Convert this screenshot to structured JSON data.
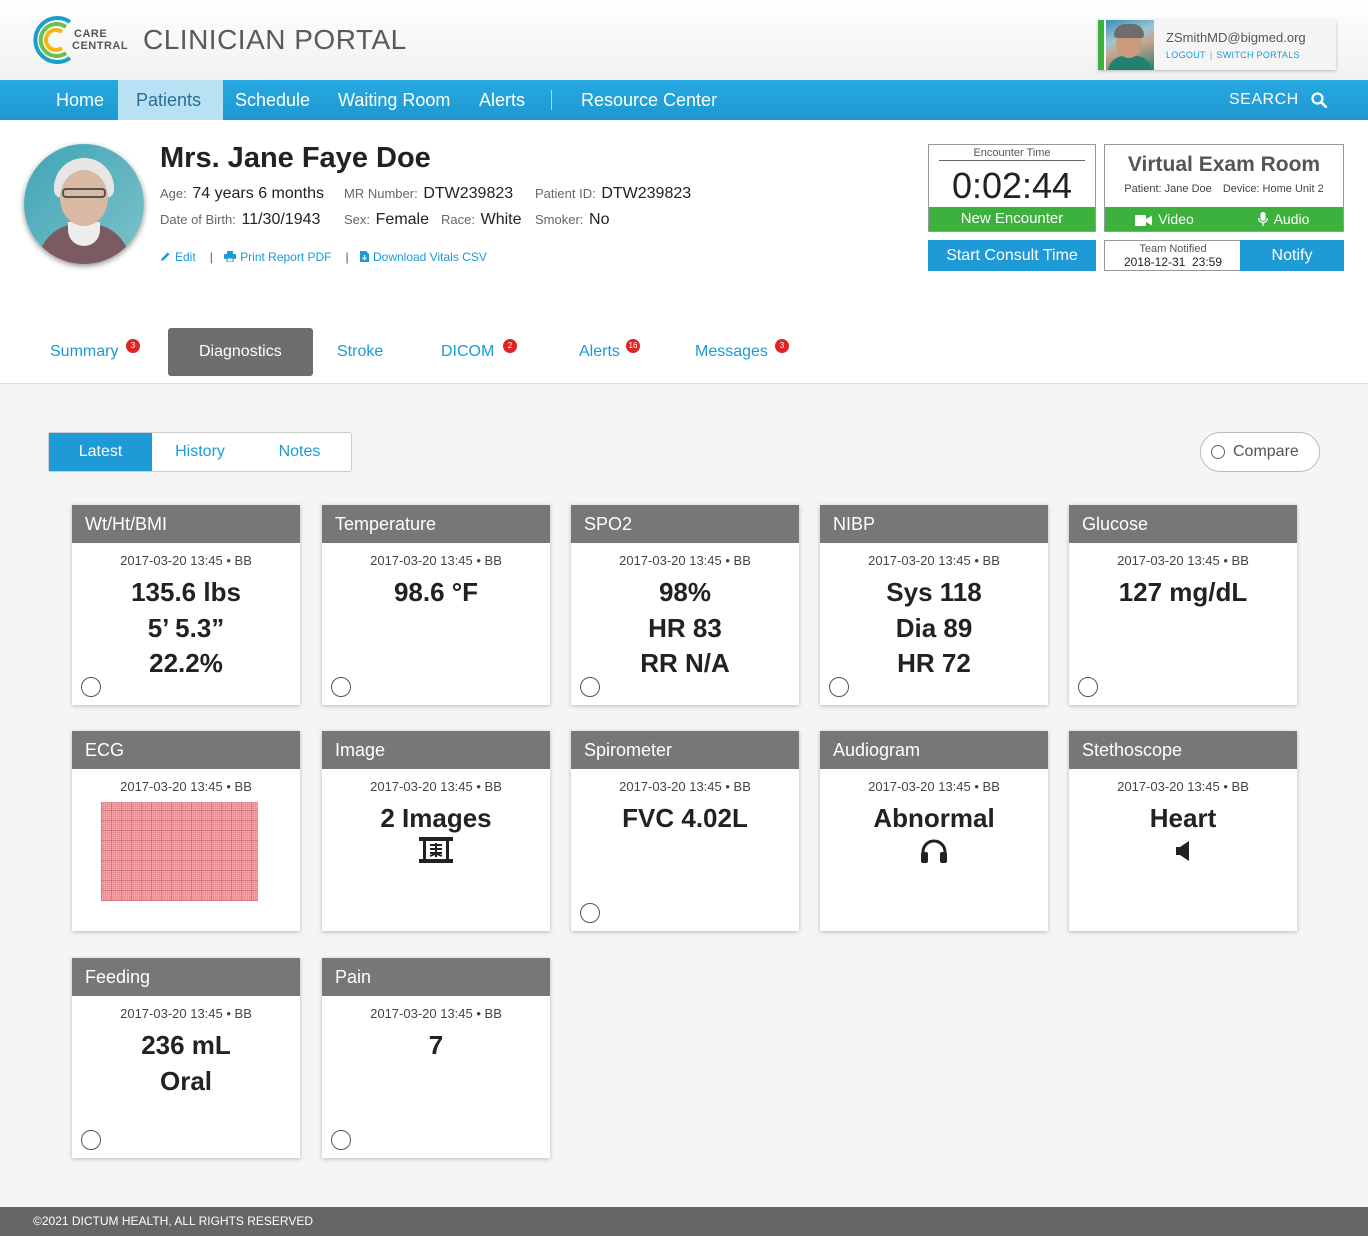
{
  "app": {
    "logo_line1": "CARE",
    "logo_line2": "CENTRAL",
    "title": "CLINICIAN PORTAL"
  },
  "user": {
    "email": "ZSmithMD@bigmed.org",
    "logout": "LOGOUT",
    "switch_portals": "SWITCH PORTALS"
  },
  "nav": {
    "items": [
      {
        "label": "Home"
      },
      {
        "label": "Patients",
        "active": true
      },
      {
        "label": "Schedule"
      },
      {
        "label": "Waiting Room"
      },
      {
        "label": "Alerts"
      },
      {
        "label": "Resource Center"
      }
    ],
    "search_label": "SEARCH"
  },
  "patient": {
    "name": "Mrs. Jane Faye Doe",
    "age_label": "Age:",
    "age": "74 years 6 months",
    "mr_label": "MR Number:",
    "mr": "DTW239823",
    "pid_label": "Patient ID:",
    "pid": "DTW239823",
    "dob_label": "Date of Birth:",
    "dob": "11/30/1943",
    "sex_label": "Sex:",
    "sex": "Female",
    "race_label": "Race:",
    "race": "White",
    "smoker_label": "Smoker:",
    "smoker": "No",
    "links": {
      "edit": "Edit",
      "print": "Print Report PDF",
      "download": "Download Vitals CSV"
    }
  },
  "encounter": {
    "label": "Encounter Time",
    "time": "0:02:44",
    "new_button": "New Encounter",
    "consult_button": "Start Consult Time"
  },
  "virtual_exam": {
    "title": "Virtual Exam Room",
    "patient": "Patient: Jane Doe",
    "device": "Device: Home Unit 2",
    "video": "Video",
    "audio": "Audio"
  },
  "team": {
    "label": "Team Notified",
    "time": "2018-12-31  23:59",
    "notify_button": "Notify"
  },
  "tabs": [
    {
      "label": "Summary",
      "badge": "3"
    },
    {
      "label": "Diagnostics",
      "active": true
    },
    {
      "label": "Stroke"
    },
    {
      "label": "DICOM",
      "badge": "2"
    },
    {
      "label": "Alerts",
      "badge": "16"
    },
    {
      "label": "Messages",
      "badge": "3"
    }
  ],
  "subtabs": [
    {
      "label": "Latest",
      "active": true
    },
    {
      "label": "History"
    },
    {
      "label": "Notes"
    }
  ],
  "compare_label": "Compare",
  "cards": [
    {
      "title": "Wt/Ht/BMI",
      "meta": "2017-03-20 13:45 • BB",
      "values": [
        "135.6 lbs",
        "5’ 5.3”",
        "22.2%"
      ]
    },
    {
      "title": "Temperature",
      "meta": "2017-03-20 13:45 • BB",
      "values": [
        "98.6 °F"
      ]
    },
    {
      "title": "SPO2",
      "meta": "2017-03-20 13:45 • BB",
      "values": [
        "98%",
        "HR 83",
        "RR N/A"
      ]
    },
    {
      "title": "NIBP",
      "meta": "2017-03-20 13:45 • BB",
      "values": [
        "Sys 118",
        "Dia 89",
        "HR 72"
      ]
    },
    {
      "title": "Glucose",
      "meta": "2017-03-20 13:45 • BB",
      "values": [
        "127 mg/dL"
      ]
    },
    {
      "title": "ECG",
      "meta": "2017-03-20 13:45 • BB",
      "values": []
    },
    {
      "title": "Image",
      "meta": "2017-03-20 13:45 • BB",
      "values": [
        "2 Images"
      ],
      "icon": "image-stack-icon"
    },
    {
      "title": "Spirometer",
      "meta": "2017-03-20 13:45 • BB",
      "values": [
        "FVC 4.02L"
      ]
    },
    {
      "title": "Audiogram",
      "meta": "2017-03-20 13:45 • BB",
      "values": [
        "Abnormal"
      ],
      "icon": "headphones-icon"
    },
    {
      "title": "Stethoscope",
      "meta": "2017-03-20 13:45 • BB",
      "values": [
        "Heart"
      ],
      "icon": "speaker-icon"
    },
    {
      "title": "Feeding",
      "meta": "2017-03-20 13:45 • BB",
      "values": [
        "236 mL",
        "Oral"
      ]
    },
    {
      "title": "Pain",
      "meta": "2017-03-20 13:45 • BB",
      "values": [
        "7"
      ]
    }
  ],
  "footer": "©2021 DICTUM HEALTH, ALL RIGHTS RESERVED",
  "colors": {
    "primary_blue": "#1e9ad6",
    "green": "#3db13d",
    "badge_red": "#e02424",
    "card_header": "#777777"
  }
}
